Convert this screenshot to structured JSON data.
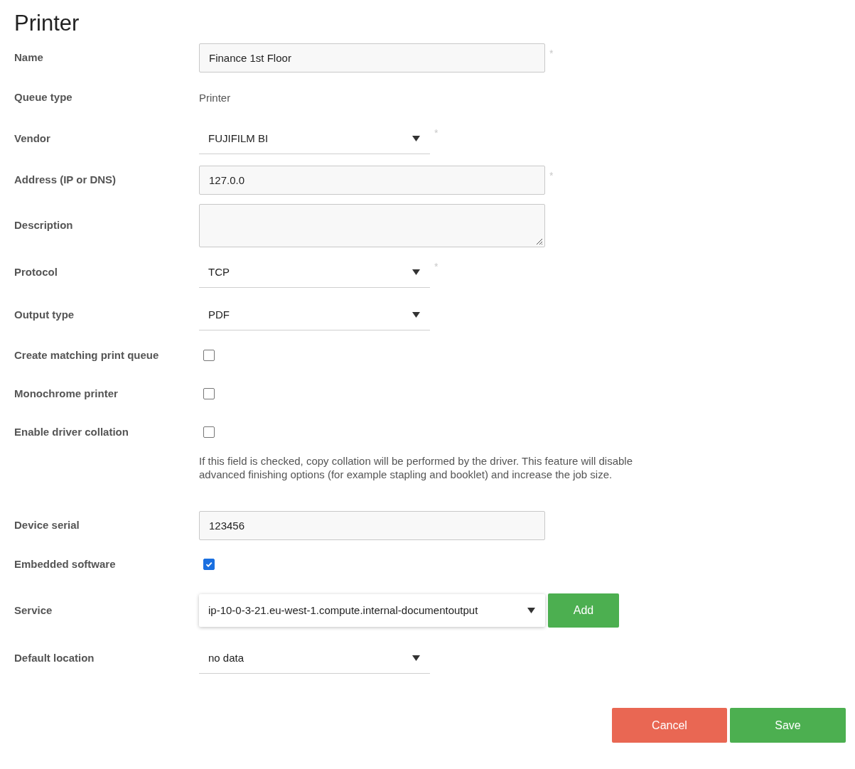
{
  "title": "Printer",
  "fields": [
    {
      "kind": "input",
      "label": "Name",
      "value": "Finance 1st Floor",
      "marker": "*"
    },
    {
      "kind": "text",
      "label": "Queue type",
      "value": "Printer"
    },
    {
      "kind": "select",
      "label": "Vendor",
      "value": "FUJIFILM BI",
      "marker": "*"
    },
    {
      "kind": "input",
      "label": "Address (IP or DNS)",
      "value": "127.0.0",
      "marker": "*"
    },
    {
      "kind": "textarea",
      "label": "Description"
    },
    {
      "kind": "select",
      "label": "Protocol",
      "value": "TCP",
      "marker": "*"
    },
    {
      "kind": "select",
      "label": "Output type",
      "value": "PDF"
    },
    {
      "kind": "checkbox",
      "label": "Create matching print queue",
      "checked": false
    },
    {
      "kind": "checkbox",
      "label": "Monochrome printer",
      "checked": false
    },
    {
      "kind": "checkbox",
      "label": "Enable driver collation",
      "checked": false
    },
    {
      "kind": "note",
      "text": "If this field is checked, copy collation will be performed by the driver. This feature will disable advanced finishing options (for example stapling and booklet) and increase the job size."
    },
    {
      "kind": "input",
      "label": "Device serial",
      "value": "123456"
    },
    {
      "kind": "checkbox",
      "label": "Embedded software",
      "checked": true
    },
    {
      "kind": "service",
      "label": "Service",
      "value": "ip-10-0-3-21.eu-west-1.compute.internal-documentoutput",
      "button": "Add"
    },
    {
      "kind": "select",
      "label": "Default location",
      "value": "no data"
    }
  ],
  "actions": [
    {
      "kind": "cancel",
      "label": "Cancel"
    },
    {
      "kind": "save",
      "label": "Save"
    }
  ]
}
